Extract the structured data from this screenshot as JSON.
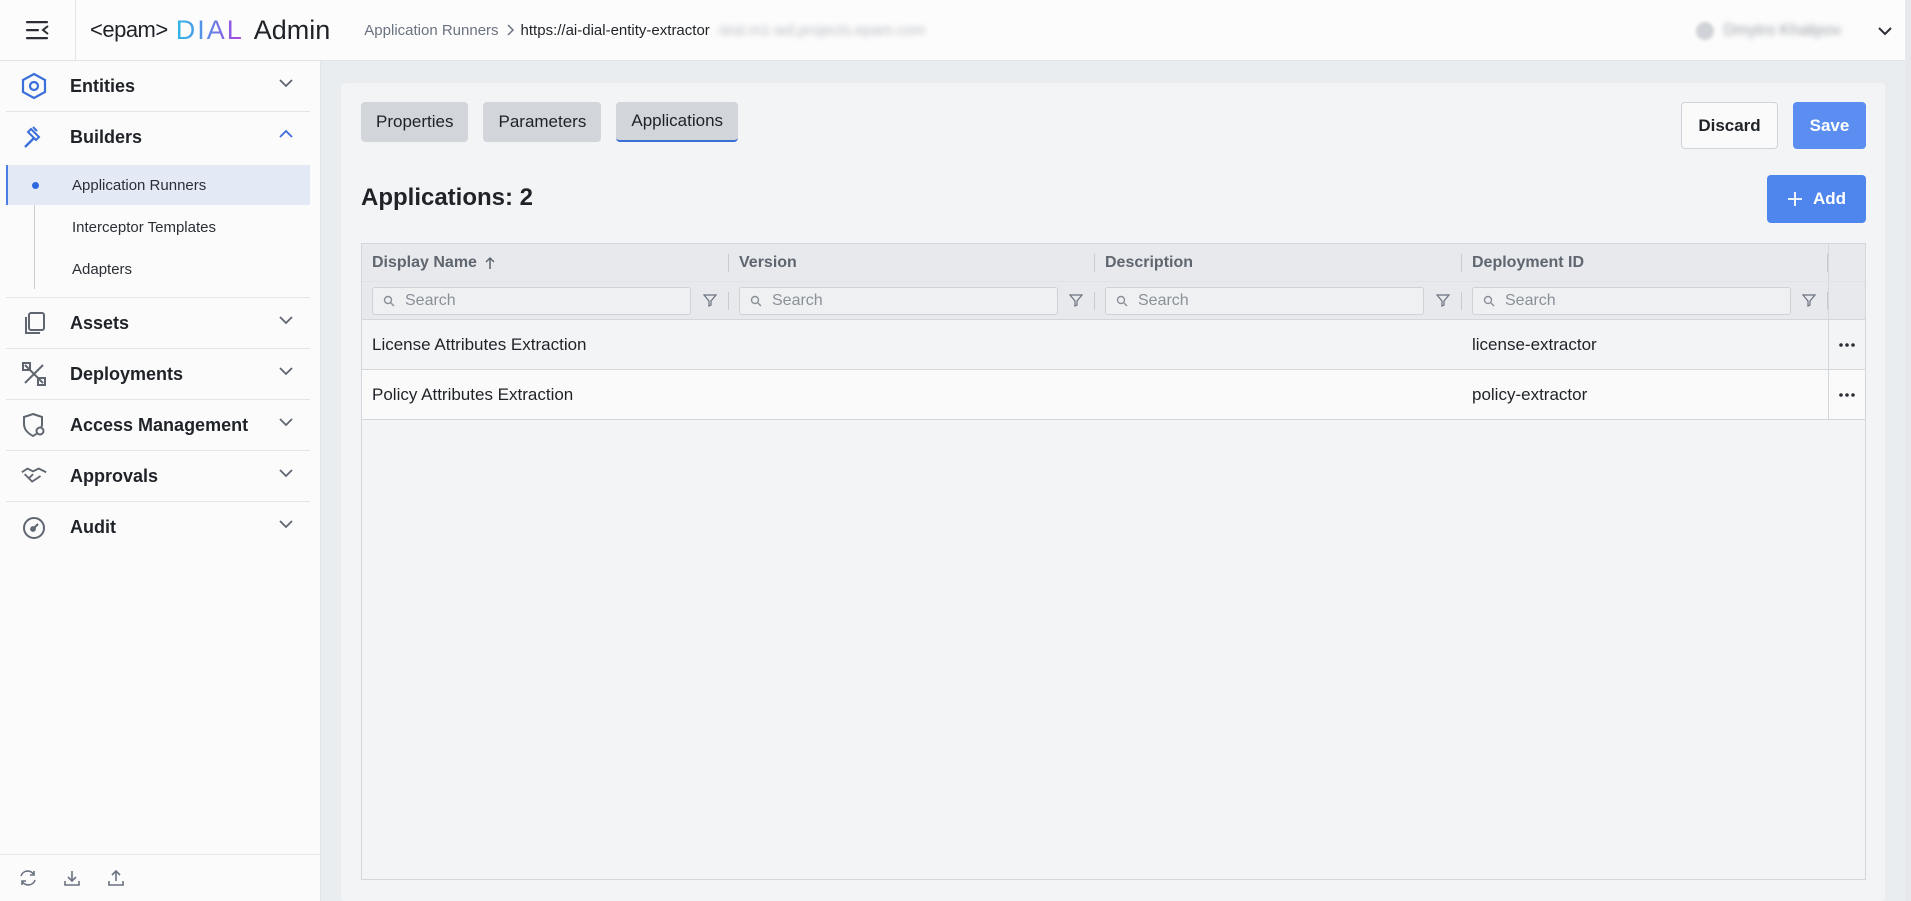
{
  "header": {
    "logo_epam": "<epam>",
    "logo_dial": "DIAL",
    "logo_admin": "Admin",
    "breadcrumb_parent": "Application Runners",
    "breadcrumb_current": "https://ai-dial-entity-extractor",
    "breadcrumb_blurred": "-test.m1-wd.projects.epam.com",
    "user_name": "Dmytro Khalipov"
  },
  "sidebar": {
    "groups": [
      {
        "label": "Entities",
        "icon": "hexagon-icon",
        "expanded": false
      },
      {
        "label": "Builders",
        "icon": "hammer-icon",
        "expanded": true
      },
      {
        "label": "Assets",
        "icon": "files-icon",
        "expanded": false
      },
      {
        "label": "Deployments",
        "icon": "tools-icon",
        "expanded": false
      },
      {
        "label": "Access Management",
        "icon": "shield-gear-icon",
        "expanded": false
      },
      {
        "label": "Approvals",
        "icon": "handshake-icon",
        "expanded": false
      },
      {
        "label": "Audit",
        "icon": "gauge-icon",
        "expanded": false
      }
    ],
    "builders_items": [
      {
        "label": "Application Runners",
        "active": true
      },
      {
        "label": "Interceptor Templates",
        "active": false
      },
      {
        "label": "Adapters",
        "active": false
      }
    ],
    "footer_icons": [
      "refresh-icon",
      "download-icon",
      "upload-icon"
    ]
  },
  "main": {
    "tabs": [
      {
        "label": "Properties",
        "active": false
      },
      {
        "label": "Parameters",
        "active": false
      },
      {
        "label": "Applications",
        "active": true
      }
    ],
    "discard_label": "Discard",
    "save_label": "Save",
    "title": "Applications: 2",
    "add_label": "Add",
    "table": {
      "columns": [
        "Display Name",
        "Version",
        "Description",
        "Deployment ID"
      ],
      "sort_column": "Display Name",
      "sort_direction": "asc",
      "search_placeholder": "Search",
      "rows": [
        {
          "display_name": "License Attributes Extraction",
          "version": "",
          "description": "",
          "deployment_id": "license-extractor"
        },
        {
          "display_name": "Policy Attributes Extraction",
          "version": "",
          "description": "",
          "deployment_id": "policy-extractor"
        }
      ]
    }
  },
  "colors": {
    "accent": "#4e86ee",
    "save_button": "#5b8ef0",
    "active_nav_bg": "#e4e9f6"
  }
}
